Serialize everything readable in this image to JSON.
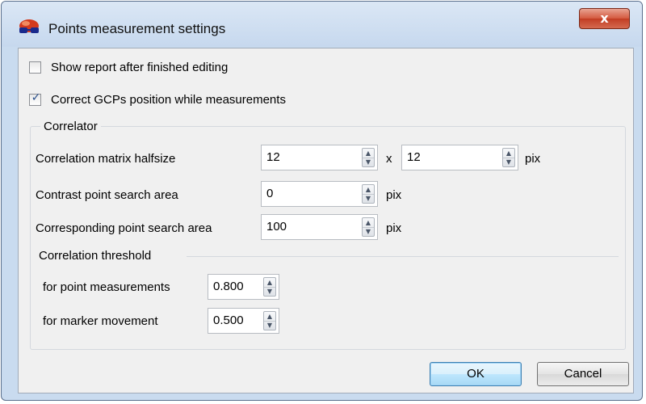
{
  "window": {
    "title": "Points measurement settings",
    "close_label": "x",
    "app_icon": "stereo-glasses-icon"
  },
  "options": {
    "show_report": {
      "label": "Show report after finished editing",
      "checked": false
    },
    "correct_gcps": {
      "label": "Correct GCPs position while measurements",
      "checked": true,
      "mark": "✓"
    }
  },
  "correlator": {
    "title": "Correlator",
    "matrix_halfsize": {
      "label": "Correlation matrix halfsize",
      "value_x": "12",
      "separator": "x",
      "value_y": "12",
      "unit": "pix"
    },
    "contrast_area": {
      "label": "Contrast point search area",
      "value": "0",
      "unit": "pix"
    },
    "corresponding_area": {
      "label": "Corresponding point search area",
      "value": "100",
      "unit": "pix"
    },
    "threshold": {
      "title": "Correlation threshold",
      "point_measurements": {
        "label": "for point measurements",
        "value": "0.800"
      },
      "marker_movement": {
        "label": "for marker movement",
        "value": "0.500"
      }
    }
  },
  "buttons": {
    "ok": "OK",
    "cancel": "Cancel"
  },
  "spin_arrows": {
    "up": "▲",
    "down": "▼"
  },
  "colors": {
    "close_button": "#c9452b",
    "window_frame": "#c9dbef",
    "client_bg": "#f0f0f0"
  }
}
